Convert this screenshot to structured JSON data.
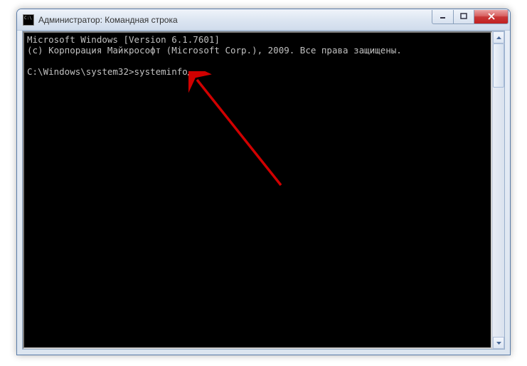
{
  "window": {
    "title": "Администратор: Командная строка"
  },
  "console": {
    "line1": "Microsoft Windows [Version 6.1.7601]",
    "line2": "(c) Корпорация Майкрософт (Microsoft Corp.), 2009. Все права защищены.",
    "prompt": "C:\\Windows\\system32>",
    "command": "systeminfo"
  }
}
